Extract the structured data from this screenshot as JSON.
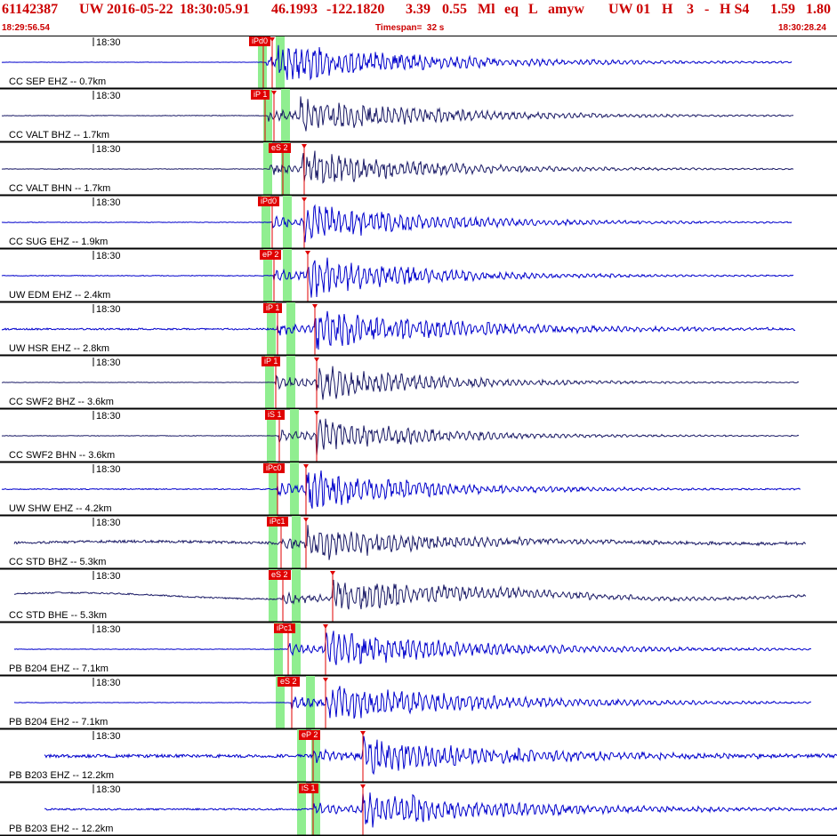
{
  "header": {
    "event_id": "61142387",
    "network": "UW",
    "date": "2016-05-22",
    "origin_time": "18:30:05.91",
    "lat": "46.1993",
    "lon": "-122.1820",
    "depth": "3.39",
    "magnitude": "0.55",
    "mag_type": "Ml",
    "event_type": "eq",
    "status": "L",
    "author": "amyw",
    "tail_1": "UW 01",
    "tail_2": "H",
    "tail_3": "3",
    "tail_4": "-",
    "tail_5": "H S4",
    "tail_6": "1.59",
    "tail_7": "1.80",
    "start_time": "18:29:56.54",
    "timespan": "Timespan=  32 s",
    "end_time": "18:30:28.24"
  },
  "colors": {
    "header_text": "#cc0000",
    "trace_blue": "#0000cc",
    "trace_dark": "#1a1a66",
    "pick_red": "#e00000",
    "window_green": "#90ee90",
    "panel_border": "#000000"
  },
  "panels": [
    {
      "label": "CC SEP EHZ -- 0.7km",
      "time": "18:30",
      "pick": "iPd0",
      "color": "blue",
      "amp": 0.9,
      "noise": 0.02,
      "greens": [
        296,
        314
      ],
      "picks": [
        296,
        306
      ],
      "onset": 300,
      "s_time": 312,
      "decay": 0.9,
      "end": 890,
      "lowf": 0
    },
    {
      "label": "CC VALT BHZ -- 1.7km",
      "time": "18:30",
      "pick": "iP 1",
      "color": "dark",
      "amp": 0.9,
      "noise": 0.04,
      "greens": [
        302,
        320
      ],
      "picks": [
        298,
        308
      ],
      "onset": 302,
      "s_time": 338,
      "decay": 0.7,
      "end": 892,
      "lowf": 0
    },
    {
      "label": "CC VALT BHN -- 1.7km",
      "time": "18:30",
      "pick": "eS 2",
      "color": "dark",
      "amp": 0.9,
      "noise": 0.04,
      "greens": [
        302,
        320
      ],
      "picks": [
        318,
        342
      ],
      "onset": 304,
      "s_time": 340,
      "decay": 0.6,
      "end": 892,
      "lowf": 0
    },
    {
      "label": "CC SUG EHZ -- 1.9km",
      "time": "18:30",
      "pick": "iPd0",
      "color": "blue",
      "amp": 0.9,
      "noise": 0.04,
      "greens": [
        300,
        322
      ],
      "picks": [
        306,
        342
      ],
      "onset": 306,
      "s_time": 342,
      "decay": 0.7,
      "end": 890,
      "lowf": 0
    },
    {
      "label": "UW EDM EHZ -- 2.4km",
      "time": "18:30",
      "pick": "eP 2",
      "color": "blue",
      "amp": 1.0,
      "noise": 0.05,
      "greens": [
        302,
        322
      ],
      "picks": [
        308,
        346
      ],
      "onset": 308,
      "s_time": 346,
      "decay": 0.5,
      "end": 892,
      "lowf": 0
    },
    {
      "label": "UW HSR EHZ -- 2.8km",
      "time": "18:30",
      "pick": "iP 1",
      "color": "blue",
      "amp": 1.0,
      "noise": 0.12,
      "greens": [
        306,
        326
      ],
      "picks": [
        312,
        354
      ],
      "onset": 312,
      "s_time": 354,
      "decay": 0.8,
      "end": 894,
      "lowf": 0
    },
    {
      "label": "CC SWF2 BHZ -- 3.6km",
      "time": "18:30",
      "pick": "iP 1",
      "color": "dark",
      "amp": 0.9,
      "noise": 0.03,
      "greens": [
        304,
        326
      ],
      "picks": [
        310,
        356
      ],
      "onset": 310,
      "s_time": 356,
      "decay": 0.5,
      "end": 898,
      "lowf": 0
    },
    {
      "label": "CC SWF2 BHN -- 3.6km",
      "time": "18:30",
      "pick": "iS 1",
      "color": "dark",
      "amp": 0.9,
      "noise": 0.04,
      "greens": [
        306,
        330
      ],
      "picks": [
        314,
        356
      ],
      "onset": 314,
      "s_time": 356,
      "decay": 0.45,
      "end": 898,
      "lowf": 0
    },
    {
      "label": "UW SHW EHZ -- 4.2km",
      "time": "18:30",
      "pick": "iPc0",
      "color": "blue",
      "amp": 1.0,
      "noise": 0.07,
      "greens": [
        308,
        330
      ],
      "picks": [
        312,
        344
      ],
      "onset": 312,
      "s_time": 344,
      "decay": 0.55,
      "end": 900,
      "lowf": 0
    },
    {
      "label": "CC STD BHZ -- 5.3km",
      "time": "18:30",
      "pick": "iPc1",
      "color": "dark",
      "amp": 0.8,
      "noise": 0.18,
      "greens": [
        308,
        332
      ],
      "picks": [
        316,
        344
      ],
      "onset": 316,
      "s_time": 344,
      "decay": 0.6,
      "end": 906,
      "lowf": 0.12
    },
    {
      "label": "CC STD BHE -- 5.3km",
      "time": "18:30",
      "pick": "eS 2",
      "color": "dark",
      "amp": 0.8,
      "noise": 0.1,
      "greens": [
        308,
        332
      ],
      "picks": [
        318,
        374
      ],
      "onset": 318,
      "s_time": 374,
      "decay": 0.9,
      "end": 906,
      "lowf": 0.35
    },
    {
      "label": "PB B204 EHZ -- 7.1km",
      "time": "18:30",
      "pick": "iPc1",
      "color": "blue",
      "amp": 0.9,
      "noise": 0.04,
      "greens": [
        314,
        332
      ],
      "picks": [
        324,
        366
      ],
      "onset": 324,
      "s_time": 366,
      "decay": 0.9,
      "end": 912,
      "lowf": 0
    },
    {
      "label": "PB B204 EH2 -- 7.1km",
      "time": "18:30",
      "pick": "eS 2",
      "color": "blue",
      "amp": 0.9,
      "noise": 0.03,
      "greens": [
        316,
        348
      ],
      "picks": [
        328,
        366
      ],
      "onset": 328,
      "s_time": 366,
      "decay": 1.0,
      "end": 912,
      "lowf": 0
    },
    {
      "label": "PB B203 EHZ -- 12.2km",
      "time": "18:30",
      "pick": "eP 2",
      "color": "blue",
      "amp": 0.9,
      "noise": 0.22,
      "greens": [
        340,
        354
      ],
      "picks": [
        352,
        408
      ],
      "onset": 352,
      "s_time": 408,
      "decay": 0.8,
      "end": 941,
      "lowf": 0
    },
    {
      "label": "PB B203 EH2 -- 12.2km",
      "time": "18:30",
      "pick": "iS 1",
      "color": "blue",
      "amp": 0.9,
      "noise": 0.12,
      "greens": [
        340,
        354
      ],
      "picks": [
        352,
        408
      ],
      "onset": 352,
      "s_time": 408,
      "decay": 0.9,
      "end": 941,
      "lowf": 0
    }
  ]
}
